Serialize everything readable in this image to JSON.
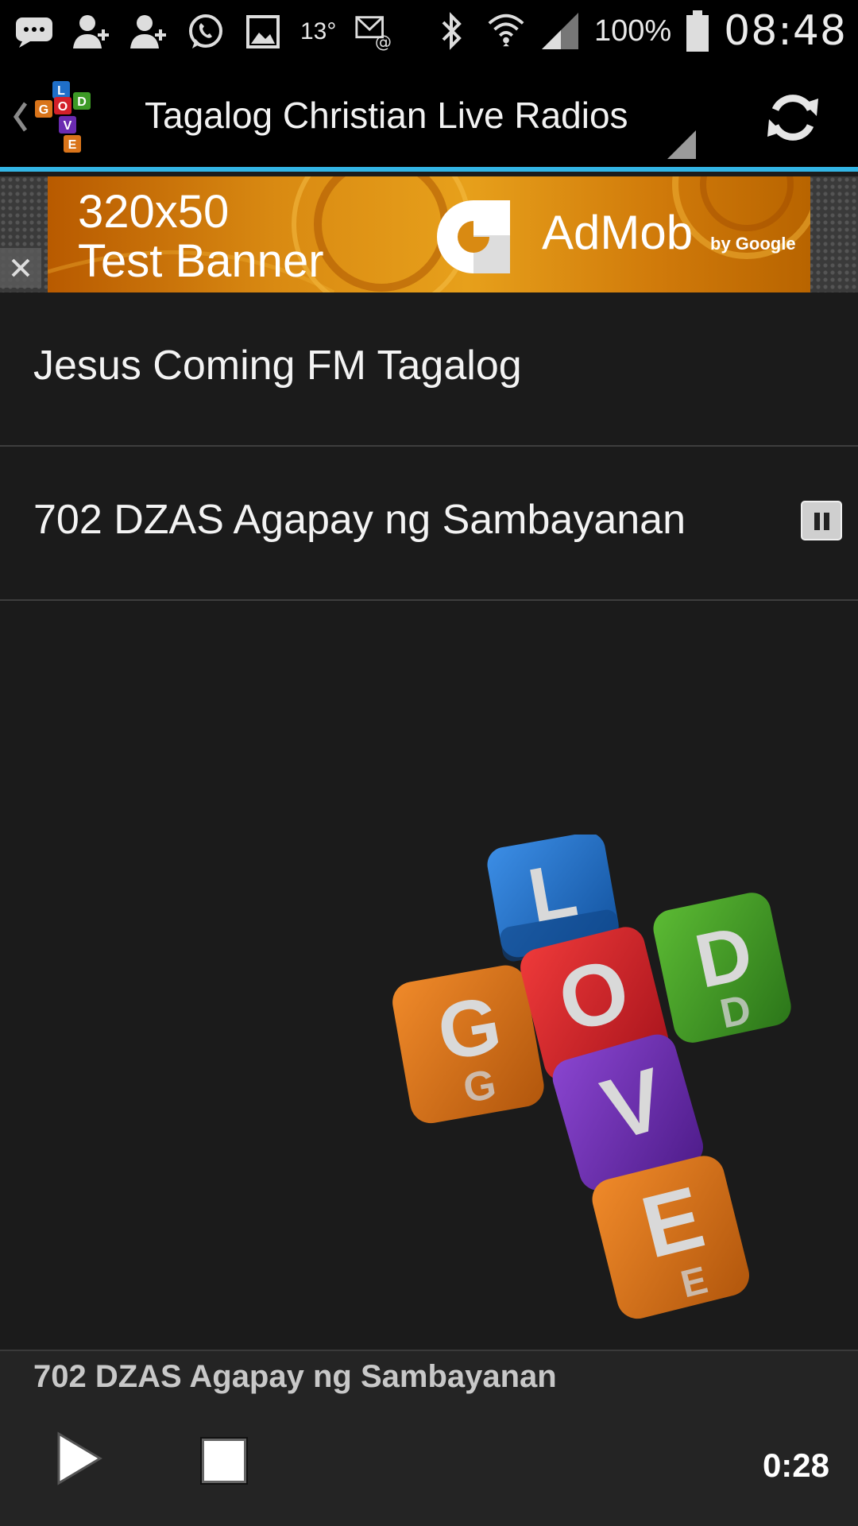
{
  "status_bar": {
    "icons_left": [
      "message-icon",
      "add-contact-icon",
      "add-contact-icon",
      "whatsapp-icon",
      "gallery-icon"
    ],
    "temperature": "13°",
    "icons_right": [
      "bluetooth-icon",
      "wifi-icon",
      "signal-icon",
      "battery-icon"
    ],
    "battery": "100%",
    "clock": "08:48"
  },
  "action_bar": {
    "title": "Tagalog Christian Live Radios",
    "logo_letters": [
      "L",
      "G",
      "O",
      "D",
      "V",
      "E"
    ]
  },
  "ad": {
    "line1": "320x50",
    "line2": "Test Banner",
    "brand": "AdMob",
    "by": "by Google"
  },
  "stations": [
    {
      "name": "Jesus Coming FM Tagalog",
      "playing": false
    },
    {
      "name": "702 DZAS Agapay ng Sambayanan",
      "playing": true
    }
  ],
  "artwork": {
    "letters": [
      "L",
      "G",
      "O",
      "D",
      "V",
      "E"
    ]
  },
  "player": {
    "now_playing": "702 DZAS Agapay ng Sambayanan",
    "elapsed": "0:28"
  },
  "colors": {
    "accent": "#33b5e5",
    "background": "#1b1b1b",
    "cube_blue": "#1f6fc9",
    "cube_red": "#d3202a",
    "cube_green": "#3d9a26",
    "cube_orange": "#d9741a",
    "cube_purple": "#6a2bb0"
  }
}
